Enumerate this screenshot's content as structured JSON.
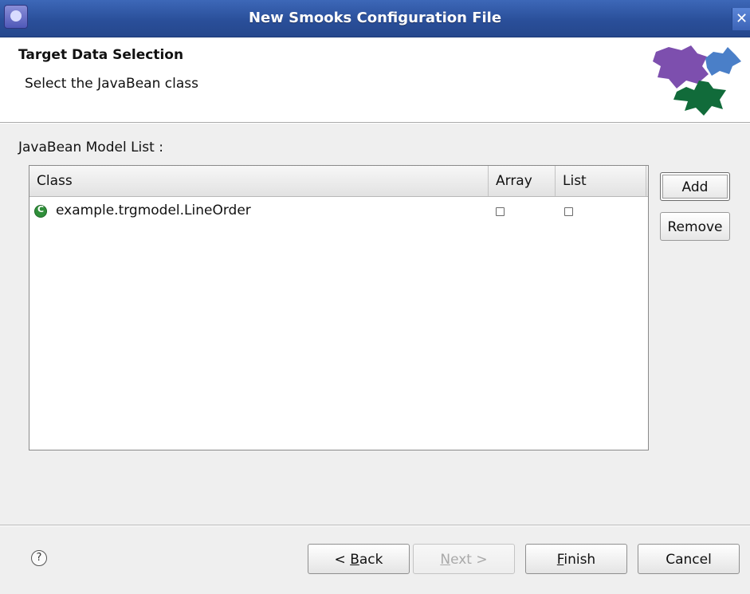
{
  "window": {
    "title": "New Smooks Configuration File",
    "close_symbol": "✕"
  },
  "header": {
    "title": "Target Data Selection",
    "description": "Select the JavaBean class",
    "banner_icon": "smooks-banner-graphic"
  },
  "list": {
    "label": "JavaBean Model List :",
    "columns": [
      "Class",
      "Array",
      "List"
    ],
    "rows": [
      {
        "class_name": "example.trgmodel.LineOrder",
        "array": false,
        "list": false,
        "icon": "class-icon"
      }
    ]
  },
  "side_buttons": {
    "add": "Add",
    "remove": "Remove"
  },
  "footer": {
    "help_symbol": "?",
    "back_prefix": "< ",
    "back_mnemonic": "B",
    "back_rest": "ack",
    "next_mnemonic": "N",
    "next_rest": "ext >",
    "finish_mnemonic": "F",
    "finish_rest": "inish",
    "cancel": "Cancel"
  },
  "colors": {
    "titlebar": "#2a4f9a",
    "class_icon": "#2f8f3a",
    "banner_purple": "#7d4fae",
    "banner_blue": "#4a7fc8",
    "banner_green": "#116b3a"
  }
}
